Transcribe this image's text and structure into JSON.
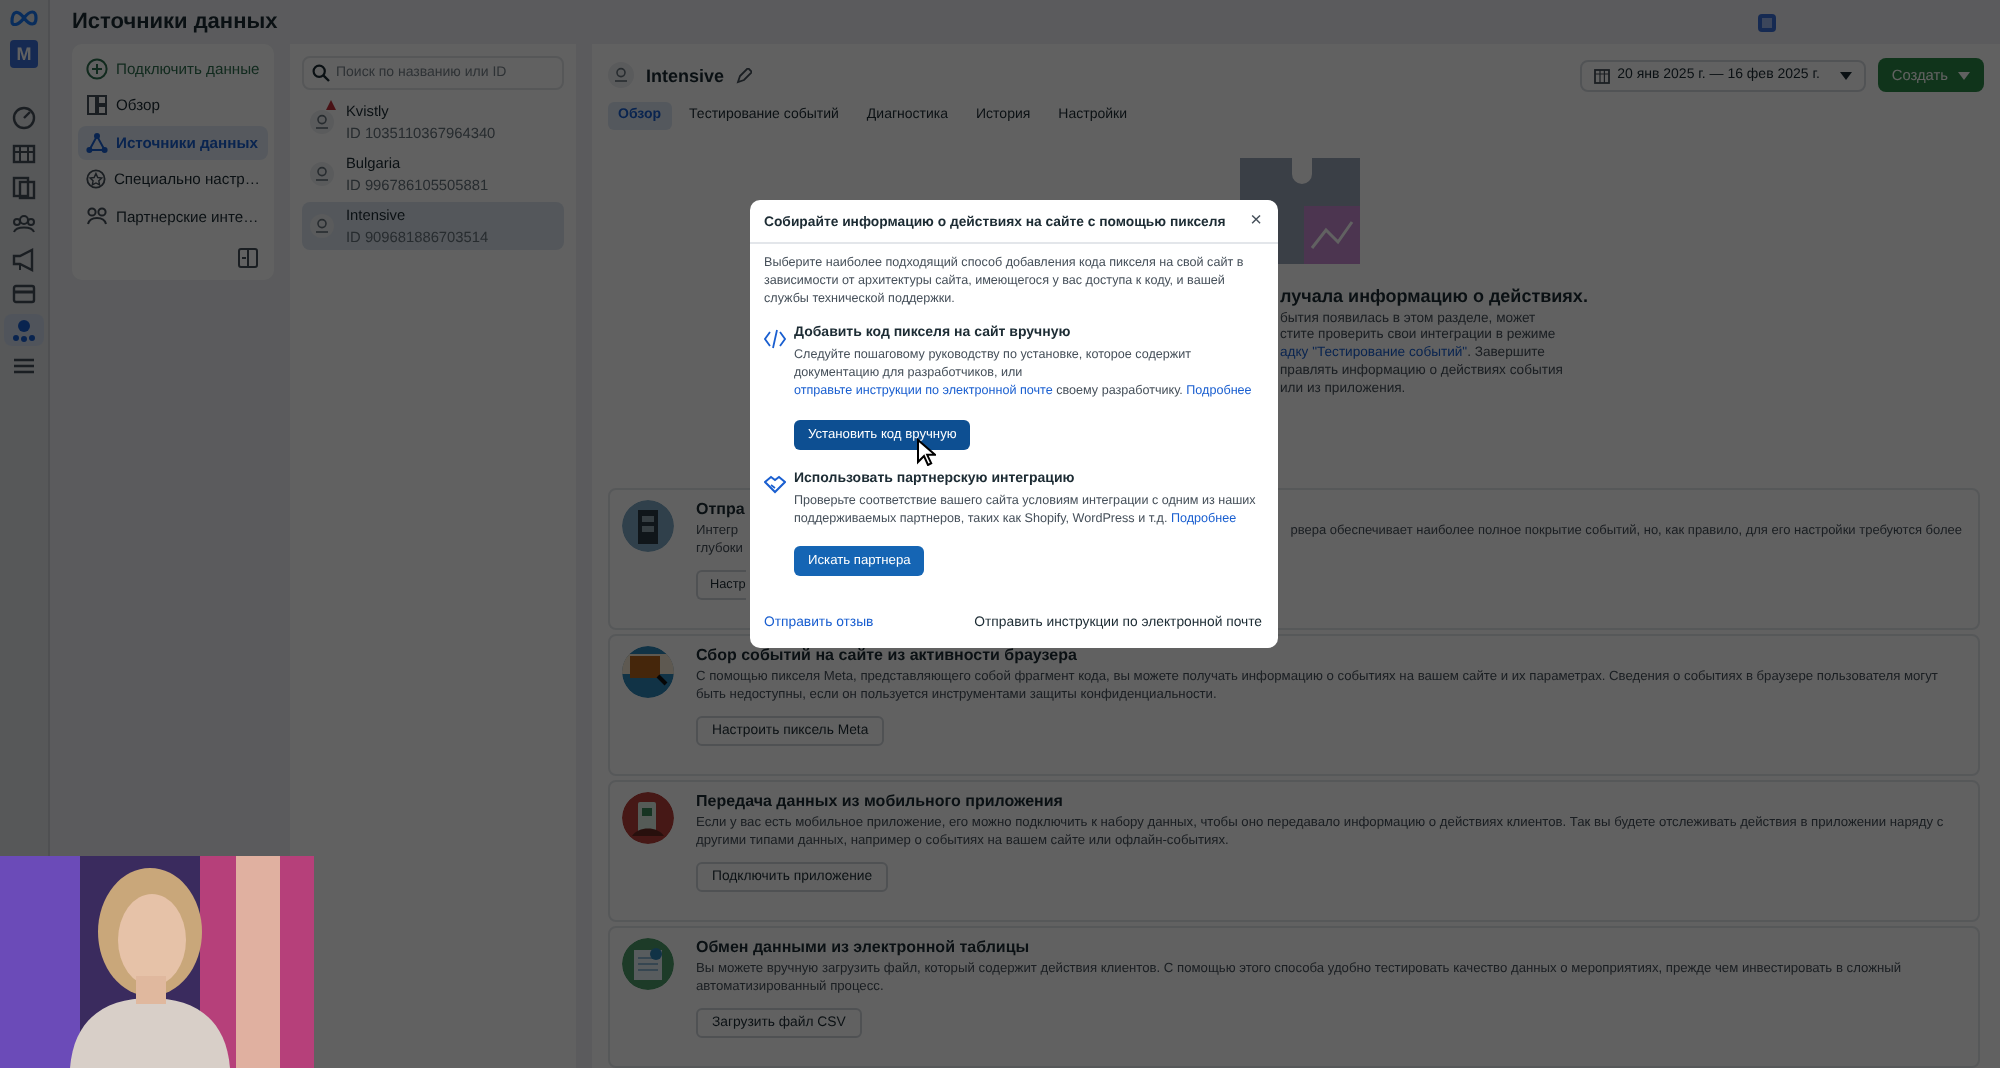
{
  "rail": {
    "avatar": "M",
    "items": [
      {
        "selected": false
      },
      {
        "selected": false
      },
      {
        "selected": false
      },
      {
        "selected": false
      },
      {
        "selected": false
      },
      {
        "selected": false
      },
      {
        "selected": true
      },
      {
        "selected": false
      }
    ]
  },
  "page_title": "Источники данных",
  "nav": {
    "items": [
      {
        "label": "Подключить данные",
        "kind": "action",
        "selected": false
      },
      {
        "label": "Обзор",
        "kind": "link",
        "selected": false
      },
      {
        "label": "Источники данных",
        "kind": "link",
        "selected": true
      },
      {
        "label": "Специально настр…",
        "kind": "link",
        "selected": false
      },
      {
        "label": "Партнерские инте…",
        "kind": "link",
        "selected": false
      }
    ]
  },
  "sources": {
    "search_placeholder": "Поиск по названию или ID",
    "items": [
      {
        "name": "Kvistly",
        "id": "ID 1035110367964340",
        "warning": true,
        "selected": false
      },
      {
        "name": "Bulgaria",
        "id": "ID 996786105505881",
        "warning": false,
        "selected": false
      },
      {
        "name": "Intensive",
        "id": "ID 909681886703514",
        "warning": false,
        "selected": true
      }
    ]
  },
  "detail": {
    "title": "Intensive",
    "date_range": "20 янв 2025 г. — 16 фев 2025 г.",
    "create_button": "Создать",
    "tabs": [
      {
        "label": "Обзор",
        "selected": true
      },
      {
        "label": "Тестирование событий",
        "selected": false
      },
      {
        "label": "Диагностика",
        "selected": false
      },
      {
        "label": "История",
        "selected": false
      },
      {
        "label": "Настройки",
        "selected": false
      }
    ],
    "empty_state": {
      "heading": "лучала информацию о действиях.",
      "lines": [
        [
          {
            "text": "бытия появилась в этом разделе, может",
            "link": false
          }
        ],
        [
          {
            "text": "стите проверить свои интеграции в режиме",
            "link": false
          }
        ],
        [
          {
            "text": "адку \"Тестирование событий\"",
            "link": true
          },
          {
            "text": ". Завершите",
            "link": false
          }
        ],
        [
          {
            "text": "правлять информацию о действиях события",
            "link": false
          }
        ],
        [
          {
            "text": "или из приложения.",
            "link": false
          }
        ]
      ]
    },
    "cards": [
      {
        "kind": "covered",
        "heading": "Отпра",
        "body_left": [
          "Интегр",
          "глубоки"
        ],
        "body_right": "рвера обеспечивает наиболее полное покрытие событий, но, как правило, для его настройки требуются более",
        "button": "Настр"
      },
      {
        "kind": "full",
        "heading": "Сбор событий на сайте из активности браузера",
        "body": "С помощью пикселя Meta, представляющего собой фрагмент кода, вы можете получать информацию о событиях на вашем сайте и их параметрах. Сведения о событиях в браузере пользователя могут быть недоступны, если он пользуется инструментами защиты конфиденциальности.",
        "button": "Настроить пиксель Meta"
      },
      {
        "kind": "full",
        "heading": "Передача данных из мобильного приложения",
        "body": "Если у вас есть мобильное приложение, его можно подключить к набору данных, чтобы оно передавало информацию о действиях клиентов. Так вы будете отслеживать действия в приложении наряду с другими типами данных, например о событиях на вашем сайте или офлайн-событиях.",
        "button": "Подключить приложение"
      },
      {
        "kind": "full",
        "heading": "Обмен данными из электронной таблицы",
        "body": "Вы можете вручную загрузить файл, который содержит действия клиентов. С помощью этого способа удобно тестировать качество данных о мероприятиях, прежде чем инвестировать в сложный автоматизированный процесс.",
        "button": "Загрузить файл CSV"
      }
    ]
  },
  "modal": {
    "title": "Собирайте информацию о действиях на сайте с помощью пикселя",
    "close": "×",
    "intro": "Выберите наиболее подходящий способ добавления кода пикселя на свой сайт в зависимости от архитектуры сайта, имеющегося у вас доступа к коду, и вашей службы технической поддержки.",
    "options": [
      {
        "title": "Добавить код пикселя на сайт вручную",
        "parts": [
          {
            "text": "Следуйте пошаговому руководству по установке, которое содержит документацию для разработчиков, или ",
            "link": false
          },
          {
            "text": "отправьте инструкции по электронной почте",
            "link": true
          },
          {
            "text": " своему разработчику. ",
            "link": false
          },
          {
            "text": "Подробнее",
            "link": true
          }
        ],
        "button": "Установить код вручную",
        "hovered": true
      },
      {
        "title": "Использовать партнерскую интеграцию",
        "parts": [
          {
            "text": "Проверьте соответствие вашего сайта условиям интеграции с одним из наших поддерживаемых партнеров, таких как Shopify, WordPress и т.д. ",
            "link": false
          },
          {
            "text": "Подробнее",
            "link": true
          }
        ],
        "button": "Искать партнера",
        "hovered": false
      }
    ],
    "feedback_link": "Отправить отзыв",
    "email_button": "Отправить инструкции по электронной почте"
  }
}
